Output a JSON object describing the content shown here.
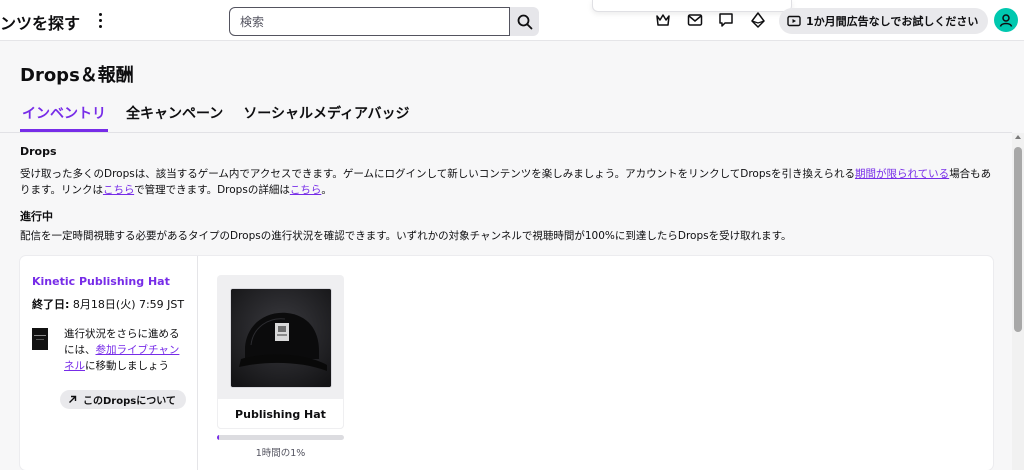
{
  "topbar": {
    "browse_label": "ンツを探す",
    "search_placeholder": "検索",
    "trial_label": "1か月間広告なしでお試しください"
  },
  "icons": {
    "more": "vertical-dots",
    "search": "magnifier",
    "crown": "crown",
    "inbox": "envelope",
    "whispers": "speech-bubble",
    "bits": "gem",
    "trial": "tv-ad",
    "avatar": "user",
    "about_arrow": "arrow-up-right"
  },
  "page": {
    "title": "Drops＆報酬",
    "tabs": [
      "インベントリ",
      "全キャンペーン",
      "ソーシャルメディアバッジ"
    ],
    "active_tab": "インベントリ"
  },
  "drops_section": {
    "title": "Drops",
    "text_1": "受け取った多くのDropsは、該当するゲーム内でアクセスできます。ゲームにログインして新しいコンテンツを楽しみましょう。アカウントをリンクしてDropsを引き換えられる",
    "link_limited": "期間が限られている",
    "text_2": "場合もあります。リンクは",
    "link_here_1": "こちら",
    "text_3": "で管理できます。Dropsの詳細は",
    "link_here_2": "こちら",
    "text_4": "。"
  },
  "in_progress": {
    "title": "進行中",
    "text": "配信を一定時間視聴する必要があるタイプのDropsの進行状況を確認できます。いずれかの対象チャンネルで視聴時間が100%に到達したらDropsを受け取れます。"
  },
  "campaign": {
    "name": "Kinetic Publishing Hat",
    "end_label": "終了日:",
    "end_date": "8月18日(火) 7:59 JST",
    "note_1": "進行状況をさらに進めるには、",
    "note_link": "参加ライブチャンネル",
    "note_2": "に移動しましょう",
    "about_label": "このDropsについて",
    "drop": {
      "name": "Publishing Hat",
      "progress_fraction": 0.01,
      "progress_label": "1時間の1%"
    }
  },
  "colors": {
    "accent": "#772ce8",
    "avatar": "#00c8af",
    "background": "#f7f7f8"
  }
}
